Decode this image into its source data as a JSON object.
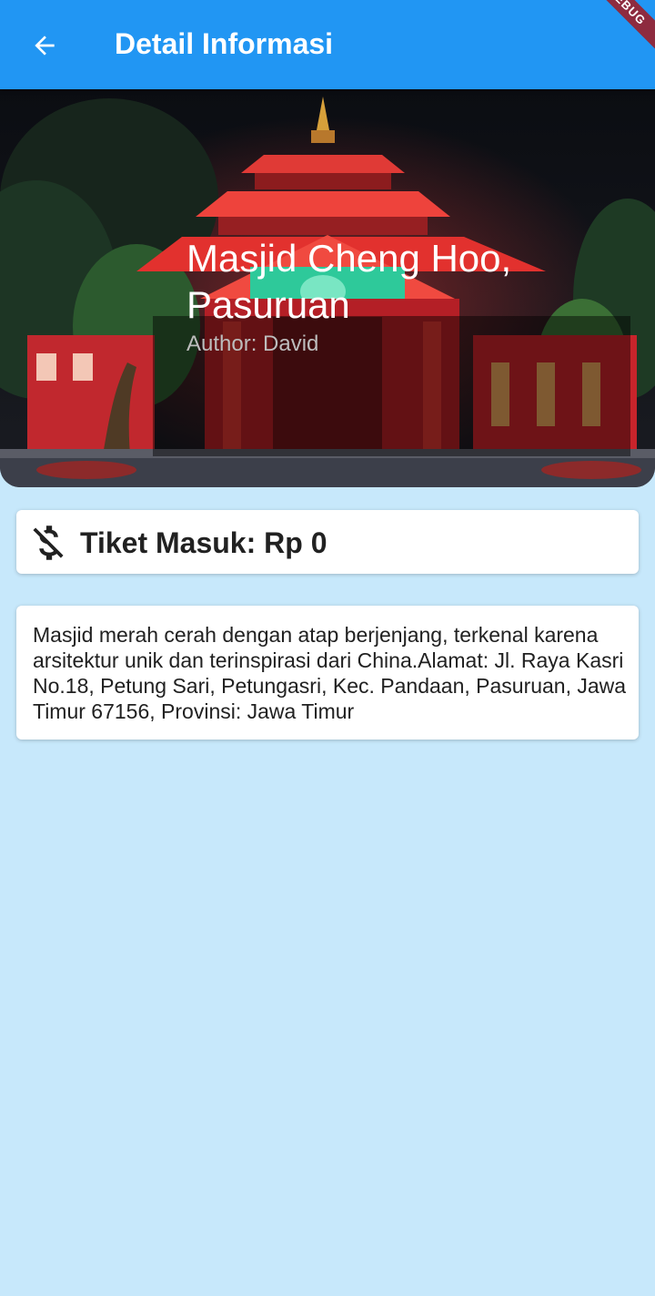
{
  "app_bar": {
    "title": "Detail Informasi",
    "back_icon": "arrow-back-icon",
    "debug_banner": "DEBUG",
    "color": "#2196f3"
  },
  "hero": {
    "title": "Masjid Cheng Hoo, Pasuruan",
    "author": "Author: David"
  },
  "ticket": {
    "icon": "money-off-icon",
    "label": "Tiket Masuk: Rp 0"
  },
  "description": {
    "text": "Masjid merah cerah dengan atap berjenjang, terkenal karena arsitektur unik dan terinspirasi dari China.Alamat: Jl. Raya Kasri No.18, Petung Sari, Petungasri, Kec. Pandaan, Pasuruan, Jawa Timur 67156, Provinsi: Jawa Timur"
  },
  "colors": {
    "background": "#c7e8fb",
    "mosque_red": "#d8232a",
    "mosque_green": "#2ec99a"
  }
}
